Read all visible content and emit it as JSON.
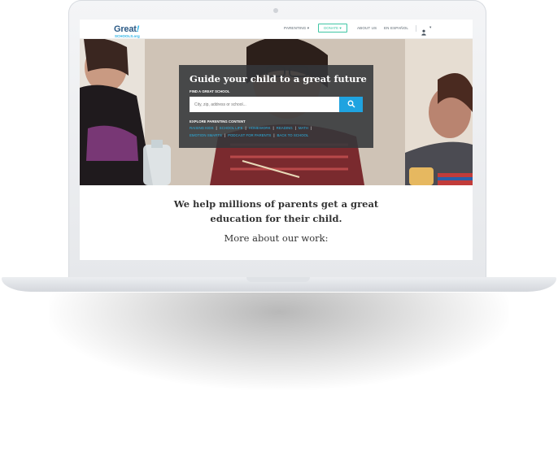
{
  "nav": {
    "logo_main": "Great",
    "logo_bang": "!",
    "logo_sub": "SCHOOLS.org",
    "parenting": "PARENTING ▾",
    "donate": "DONATE ♥",
    "about": "ABOUT US",
    "espanol": "EN ESPAÑOL",
    "user_caret": "▾"
  },
  "hero": {
    "title": "Guide your child to a great future",
    "find_label": "FIND A GREAT SCHOOL",
    "search_placeholder": "City, zip, address or school...",
    "explore_label": "EXPLORE PARENTING CONTENT",
    "links": [
      "RAISING KIDS",
      "SCHOOL LIFE",
      "HOMEWORK",
      "READING",
      "MATH",
      "EMOTION SMARTS",
      "PODCAST FOR PARENTS",
      "BACK TO SCHOOL"
    ]
  },
  "body": {
    "tagline_line1": "We help millions of parents get a great",
    "tagline_line2": "education for their child.",
    "more": "More about our work:"
  },
  "colors": {
    "brand_blue": "#2b5a86",
    "accent_blue": "#1fa3e0",
    "donate_green": "#3fc6a4"
  }
}
